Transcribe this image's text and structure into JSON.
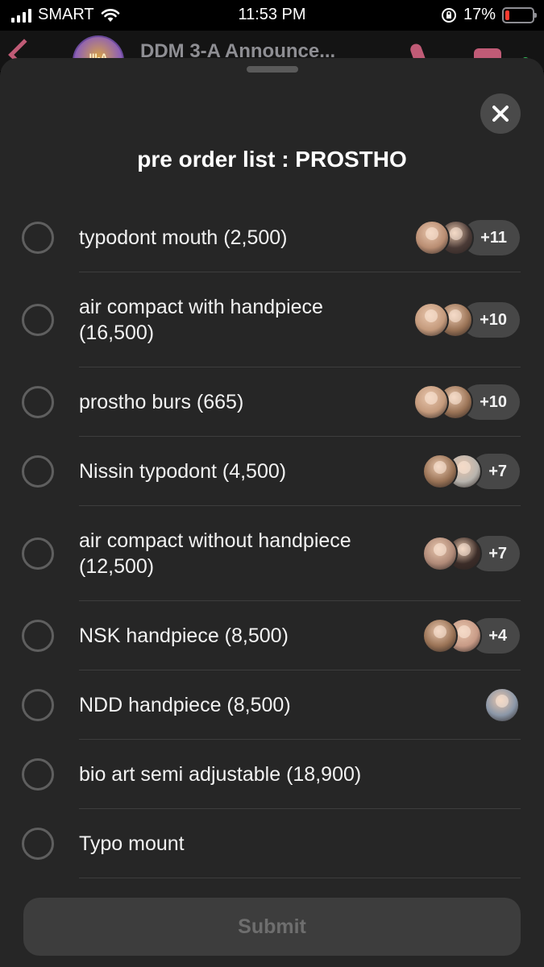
{
  "status": {
    "carrier": "SMART",
    "time": "11:53 PM",
    "battery": "17%",
    "battery_level": 0.17
  },
  "chat": {
    "title": "DDM 3-A Announce...",
    "avatar_text": "III-A"
  },
  "sheet": {
    "title": "pre order list : PROSTHO",
    "submit_label": "Submit",
    "options": [
      {
        "label": "typodont mouth (2,500)",
        "count": "+11",
        "avatars": [
          "#b98d72",
          "#4a3a36"
        ]
      },
      {
        "label": "air compact with handpiece (16,500)",
        "count": "+10",
        "avatars": [
          "#c49a7c",
          "#9a7356"
        ]
      },
      {
        "label": "prostho burs (665)",
        "count": "+10",
        "avatars": [
          "#c49a7c",
          "#9a7356"
        ]
      },
      {
        "label": "Nissin typodont (4,500)",
        "count": "+7",
        "avatars": [
          "#9a7356",
          "#b8b4ae"
        ]
      },
      {
        "label": "air compact without handpiece (12,500)",
        "count": "+7",
        "avatars": [
          "#b08a78",
          "#3b2c28"
        ]
      },
      {
        "label": "NSK handpiece (8,500)",
        "count": "+4",
        "avatars": [
          "#9a7356",
          "#c79a86"
        ]
      },
      {
        "label": "NDD handpiece (8,500)",
        "count": "",
        "avatars": [
          "#8b97a8"
        ]
      },
      {
        "label": "bio art semi adjustable (18,900)",
        "count": "",
        "avatars": []
      },
      {
        "label": "Typo mount",
        "count": "",
        "avatars": []
      }
    ]
  },
  "colors": {
    "sheet_bg": "#262626",
    "accent": "#c05b76",
    "online": "#31c45b"
  }
}
